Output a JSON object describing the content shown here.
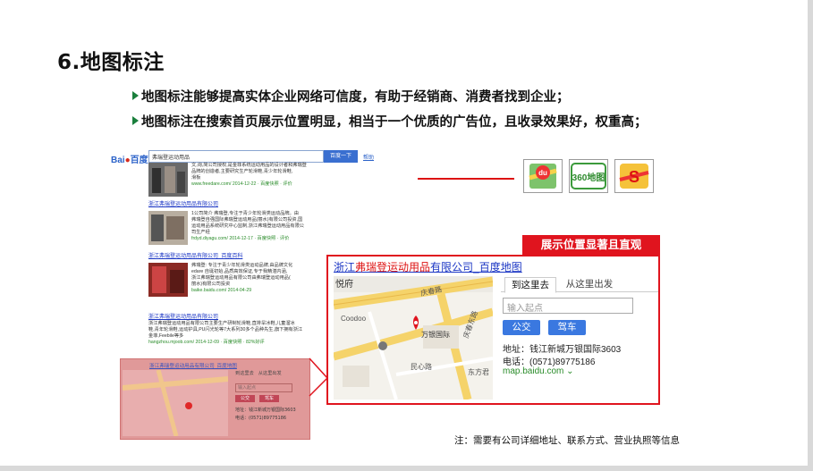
{
  "slide": {
    "title": "6.地图标注",
    "bullets": [
      "地图标注能够提高实体企业网络可信度，有助于经销商、消费者找到企业；",
      "地图标注在搜索首页展示位置明显，相当于一个优质的广告位，且收录效果好，权重高；"
    ],
    "caption": "展示位置显著且直观",
    "note": "注：需要有公司详细地址、联系方式、营业执照等信息"
  },
  "serp": {
    "logo_left": "Bai",
    "logo_right": "百度",
    "query": "弗瑞登运动用品",
    "search_button": "百度一下",
    "help": "帮助",
    "results": [
      {
        "title": "",
        "lines": [
          "文,询,简公司授权,是金菲系统运动用品的设计者和弗瑞登",
          "品牌的创造者,主要研究生产轮滑鞋,青少年轮滑鞋,",
          "滑板"
        ],
        "url": "www.freedare.com/ 2014-12-22 · 百度快照 · 评价"
      },
      {
        "title": "浙江弗瑞登运动用品有限公司",
        "lines": [
          "1公司简介 弗瑞登,专注于青少年轮滑类运动品牌。由",
          "弗瑞登自强国际弗瑞登运动用品(丽水)有限公司投资,国",
          "运动用品系统研究中心监制,浙江弗瑞登运动用品有限公",
          "司生产经"
        ],
        "url": "frdyd.diyagu.com/ 2014-12-17 · 百度快照 · 评价"
      },
      {
        "title": "浙江弗瑞登运动用品有限公司_百度百科",
        "lines": [
          "弗瑞登: 专注于青少年轮滑类运动品牌,由品牌文化",
          "edare 自诞初始,品质高效保证,专于我精湛内涵,",
          "浙江弗瑞登运动用品有限公司由弗瑞登运动用品(",
          "丽水)有限公司投资"
        ],
        "url": "baike.baidu.com/ 2014-04-29"
      },
      {
        "title": "浙江弗瑞登运动用品有限公司",
        "lines": [
          "浙江弗瑞登运动用品有限公司主要生产研制轮滑鞋,直排旱冰鞋,儿童溜冰",
          "鞋,青年轮滑鞋,运动护具,PU闪光轮等7大系列30多个品种先生,旗下拥有浙江",
          "金菲,Feebile等多"
        ],
        "url": "hangzhou.mjoob.com/ 2014-12-09 · 百度快照 · 82%好评"
      }
    ],
    "pink": {
      "title": "浙江弗瑞登运动用品有限公司_百度地图",
      "tab_to": "到这里去",
      "tab_from": "从这里出发",
      "input": "输入起点",
      "bus": "公交",
      "car": "驾车",
      "address": "地址：钱江新城万银国际3603",
      "phone": "电话：(0571)89775186"
    }
  },
  "map_card": {
    "title_prefix": "浙江",
    "title_brand": "弗瑞登运动用品",
    "title_suffix": "有限公司_百度地图",
    "tab_to": "到这里去",
    "tab_from": "从这里出发",
    "start_placeholder": "输入起点",
    "bus_button": "公交",
    "car_button": "驾车",
    "address": "地址：钱江新城万银国际3603",
    "phone": "电话：(0571)89775186",
    "site": "map.baidu.com",
    "site_arrow": "⌄",
    "map_labels": {
      "north": "悦府",
      "road1": "庆春路",
      "road2": "民心路",
      "road3": "庆春东路",
      "poi1": "Coodoo",
      "poi2": "万银国际",
      "poi3": "东方君"
    }
  },
  "icons": [
    {
      "name": "baidu-map-icon",
      "label": "du"
    },
    {
      "name": "360-map-icon",
      "label": "360地图"
    },
    {
      "name": "sogou-map-icon",
      "label": "S"
    }
  ],
  "colors": {
    "accent_red": "#e0141e",
    "link_blue": "#1a35c4",
    "bullet_green": "#1a7f3c"
  }
}
